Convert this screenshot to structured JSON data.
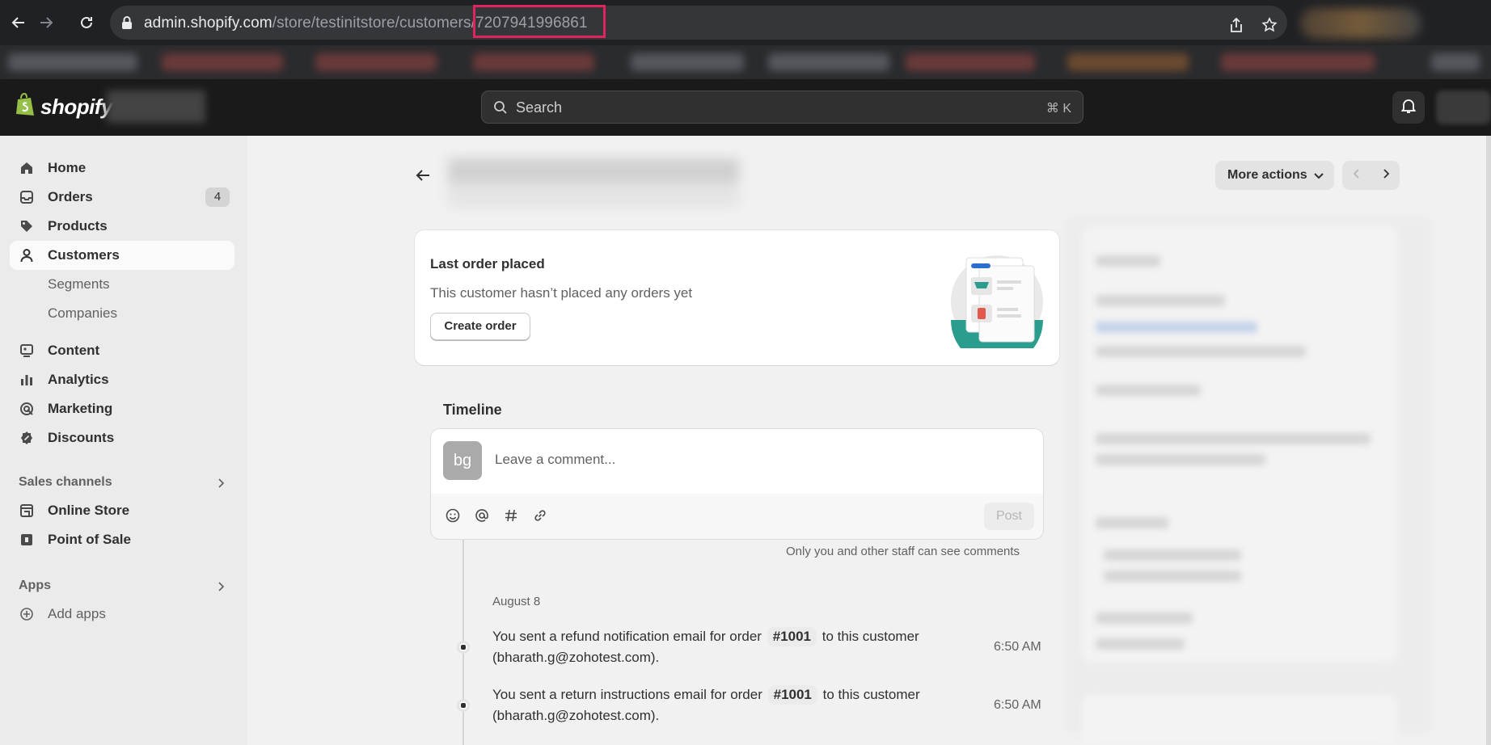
{
  "browser": {
    "url_host": "admin.shopify.com",
    "url_path": "/store/testinitstore/customers",
    "url_id": "/7207941996861"
  },
  "topbar": {
    "logo_text": "shopify",
    "search_placeholder": "Search",
    "search_shortcut": "⌘ K"
  },
  "sidebar": {
    "items": [
      {
        "label": "Home",
        "icon": "home-icon"
      },
      {
        "label": "Orders",
        "icon": "inbox-icon",
        "badge": "4"
      },
      {
        "label": "Products",
        "icon": "tag-icon"
      },
      {
        "label": "Customers",
        "icon": "person-icon",
        "active": true
      },
      {
        "label": "Segments"
      },
      {
        "label": "Companies"
      },
      {
        "label": "Content",
        "icon": "content-icon"
      },
      {
        "label": "Analytics",
        "icon": "bar-chart-icon"
      },
      {
        "label": "Marketing",
        "icon": "target-icon"
      },
      {
        "label": "Discounts",
        "icon": "discount-icon"
      }
    ],
    "sales_channels_heading": "Sales channels",
    "sales_channels": [
      {
        "label": "Online Store",
        "icon": "store-icon"
      },
      {
        "label": "Point of Sale",
        "icon": "pos-icon"
      }
    ],
    "apps_heading": "Apps",
    "add_apps_label": "Add apps"
  },
  "header": {
    "more_actions_label": "More actions"
  },
  "last_order": {
    "title": "Last order placed",
    "text": "This customer hasn’t placed any orders yet",
    "button": "Create order"
  },
  "timeline": {
    "title": "Timeline",
    "avatar_initials": "bg",
    "comment_placeholder": "Leave a comment...",
    "post_label": "Post",
    "note": "Only you and other staff can see comments",
    "date": "August 8",
    "events": [
      {
        "text_before": "You sent a refund notification email for order",
        "order": "#1001",
        "text_after": "to this customer",
        "email_line": "(bharath.g@zohotest.com).",
        "time": "6:50 AM"
      },
      {
        "text_before": "You sent a return instructions email for order",
        "order": "#1001",
        "text_after": "to this customer",
        "email_line": "(bharath.g@zohotest.com).",
        "time": "6:50 AM"
      }
    ]
  },
  "colors": {
    "highlight": "#e0245e",
    "shopify_green": "#95bf47",
    "illustration_teal": "#2a9d8f"
  }
}
